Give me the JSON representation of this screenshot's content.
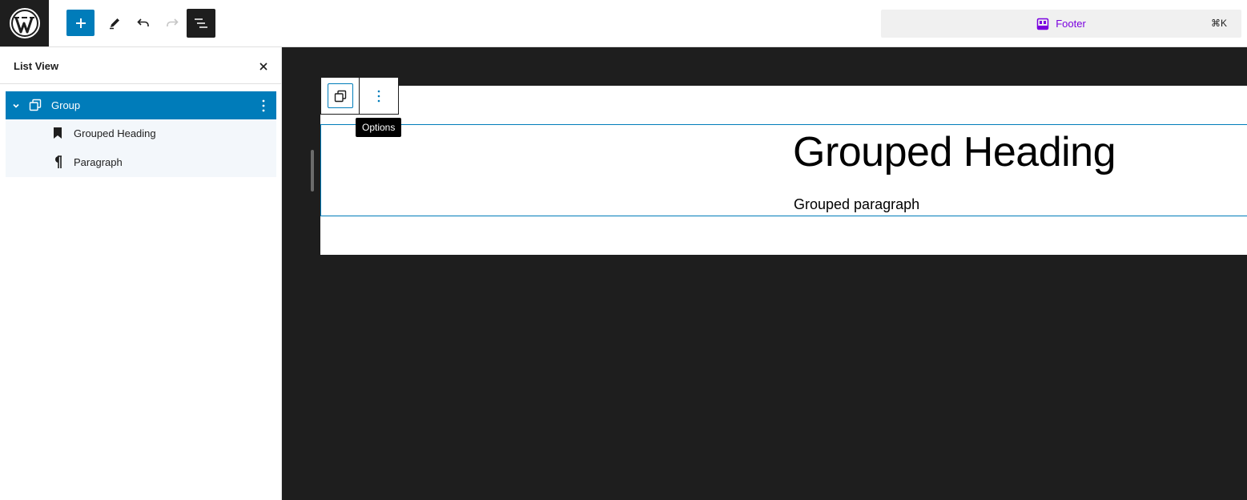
{
  "topbar": {
    "logo_icon": "wordpress-logo-icon",
    "add_block_icon": "plus-icon",
    "tools_icon": "pencil-icon",
    "undo_icon": "undo-icon",
    "redo_icon": "redo-icon",
    "list_view_icon": "list-view-icon",
    "command_bar": {
      "icon": "template-part-footer-icon",
      "label": "Footer",
      "shortcut": "⌘K"
    }
  },
  "sidebar": {
    "title": "List View",
    "close_icon": "close-icon",
    "items": [
      {
        "label": "Group",
        "icon": "group-icon",
        "selected": true,
        "expanded": true
      },
      {
        "label": "Grouped Heading",
        "icon": "bookmark-heading-icon"
      },
      {
        "label": "Paragraph",
        "icon": "pilcrow-icon"
      }
    ]
  },
  "canvas": {
    "heading": "Grouped Heading",
    "paragraph": "Grouped paragraph",
    "block_toolbar": {
      "parent_icon": "group-icon",
      "options_icon": "more-vertical-icon",
      "tooltip": "Options"
    }
  },
  "colors": {
    "accent": "#007cba",
    "dark": "#1e1e1e",
    "command_purple": "#7a00df"
  }
}
